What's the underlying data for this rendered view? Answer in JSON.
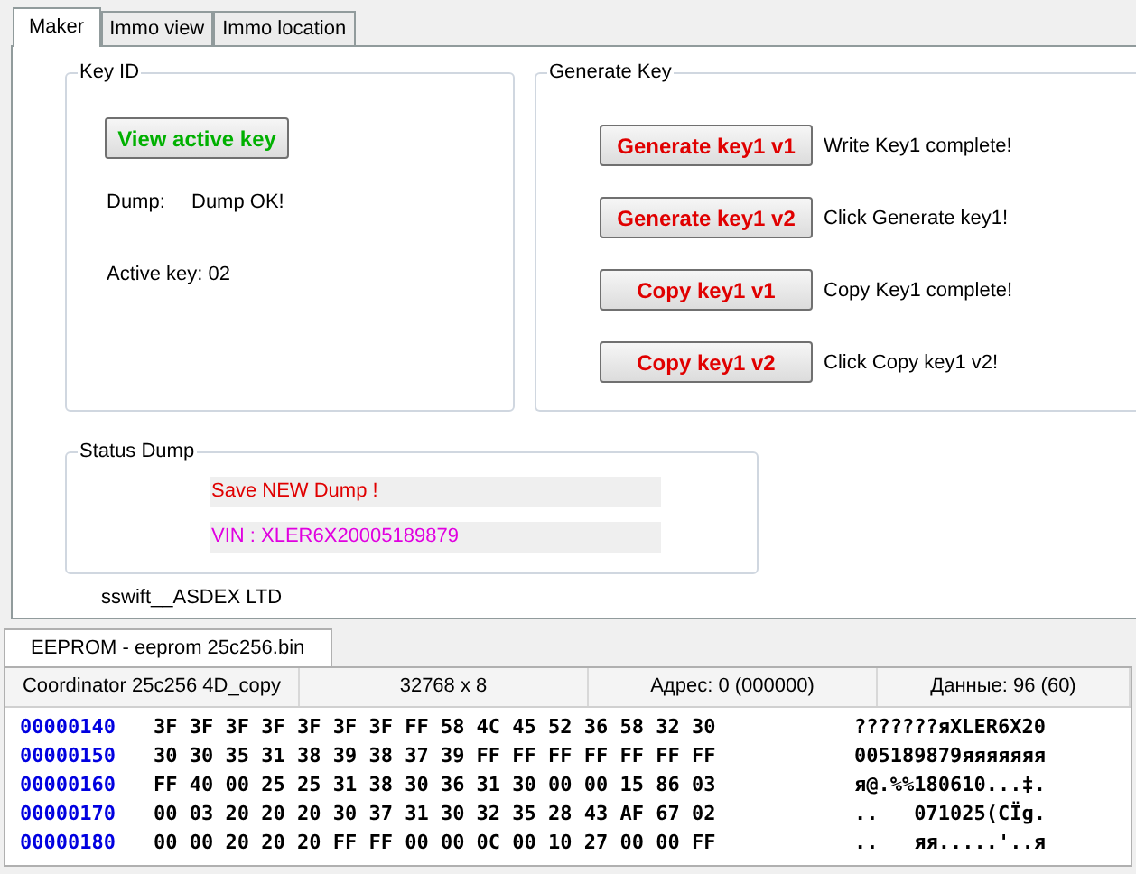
{
  "tabs": [
    {
      "label": "Maker",
      "selected": true
    },
    {
      "label": "Immo view",
      "selected": false
    },
    {
      "label": "Immo location",
      "selected": false
    }
  ],
  "key_id": {
    "title": "Key ID",
    "button": "View active key",
    "dump_label": "Dump:",
    "dump_value": "Dump OK!",
    "active_key": "Active key: 02"
  },
  "generate_key": {
    "title": "Generate Key",
    "rows": [
      {
        "button": "Generate key1 v1",
        "message": "Write Key1 complete!"
      },
      {
        "button": "Generate key1 v2",
        "message": "Click Generate key1!"
      },
      {
        "button": "Copy key1 v1",
        "message": "Copy Key1 complete!"
      },
      {
        "button": "Copy key1 v2",
        "message": "Click Copy key1 v2!"
      }
    ]
  },
  "status_dump": {
    "title": "Status Dump",
    "lines": [
      {
        "text": "Save NEW Dump !",
        "color": "#e00000"
      },
      {
        "text": "VIN : XLER6X20005189879",
        "color": "#e000e0"
      }
    ]
  },
  "footer": "sswift__ASDEX LTD",
  "editor_tab": {
    "label": "EEPROM - eeprom 25c256.bin",
    "selected": true
  },
  "status_bar": [
    "Coordinator 25c256 4D_copy",
    "32768 x 8",
    "Адрес: 0 (000000)",
    "Данные: 96 (60)"
  ],
  "hex_rows": [
    {
      "address": "00000140",
      "bytes": "3F 3F 3F 3F 3F 3F 3F FF 58 4C 45 52 36 58 32 30",
      "ascii": "???????яXLER6X20"
    },
    {
      "address": "00000150",
      "bytes": "30 30 35 31 38 39 38 37 39 FF FF FF FF FF FF FF",
      "ascii": "005189879яяяяяяя"
    },
    {
      "address": "00000160",
      "bytes": "FF 40 00 25 25 31 38 30 36 31 30 00 00 15 86 03",
      "ascii": "я@.%%180610...‡."
    },
    {
      "address": "00000170",
      "bytes": "00 03 20 20 20 30 37 31 30 32 35 28 43 AF 67 02",
      "ascii": "..   071025(CЇg."
    },
    {
      "address": "00000180",
      "bytes": "00 00 20 20 20 FF FF 00 00 0C 00 10 27 00 00 FF",
      "ascii": "..   яя.....'..я"
    }
  ]
}
